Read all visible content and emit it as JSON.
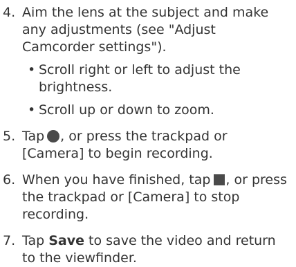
{
  "steps": [
    {
      "number": "4.",
      "text": "Aim the lens at the subject and make any adjustments (see \"Adjust Camcorder settings\").",
      "bullets": [
        {
          "marker": "•",
          "text": "Scroll right or left to adjust the brightness."
        },
        {
          "marker": "•",
          "text": "Scroll up or down to zoom."
        }
      ]
    },
    {
      "number": "5.",
      "before": "Tap",
      "icon": "record-icon",
      "after": ", or press the trackpad or [Camera] to begin recording."
    },
    {
      "number": "6.",
      "before": "When you have finished, tap",
      "icon": "stop-icon",
      "after": ", or press the trackpad or [Camera] to stop recording."
    },
    {
      "number": "7.",
      "before": "Tap ",
      "bold": "Save",
      "after": " to save the video and return to the viewfinder."
    }
  ],
  "colors": {
    "text": "#333333",
    "icon": "#4a4a4a"
  }
}
